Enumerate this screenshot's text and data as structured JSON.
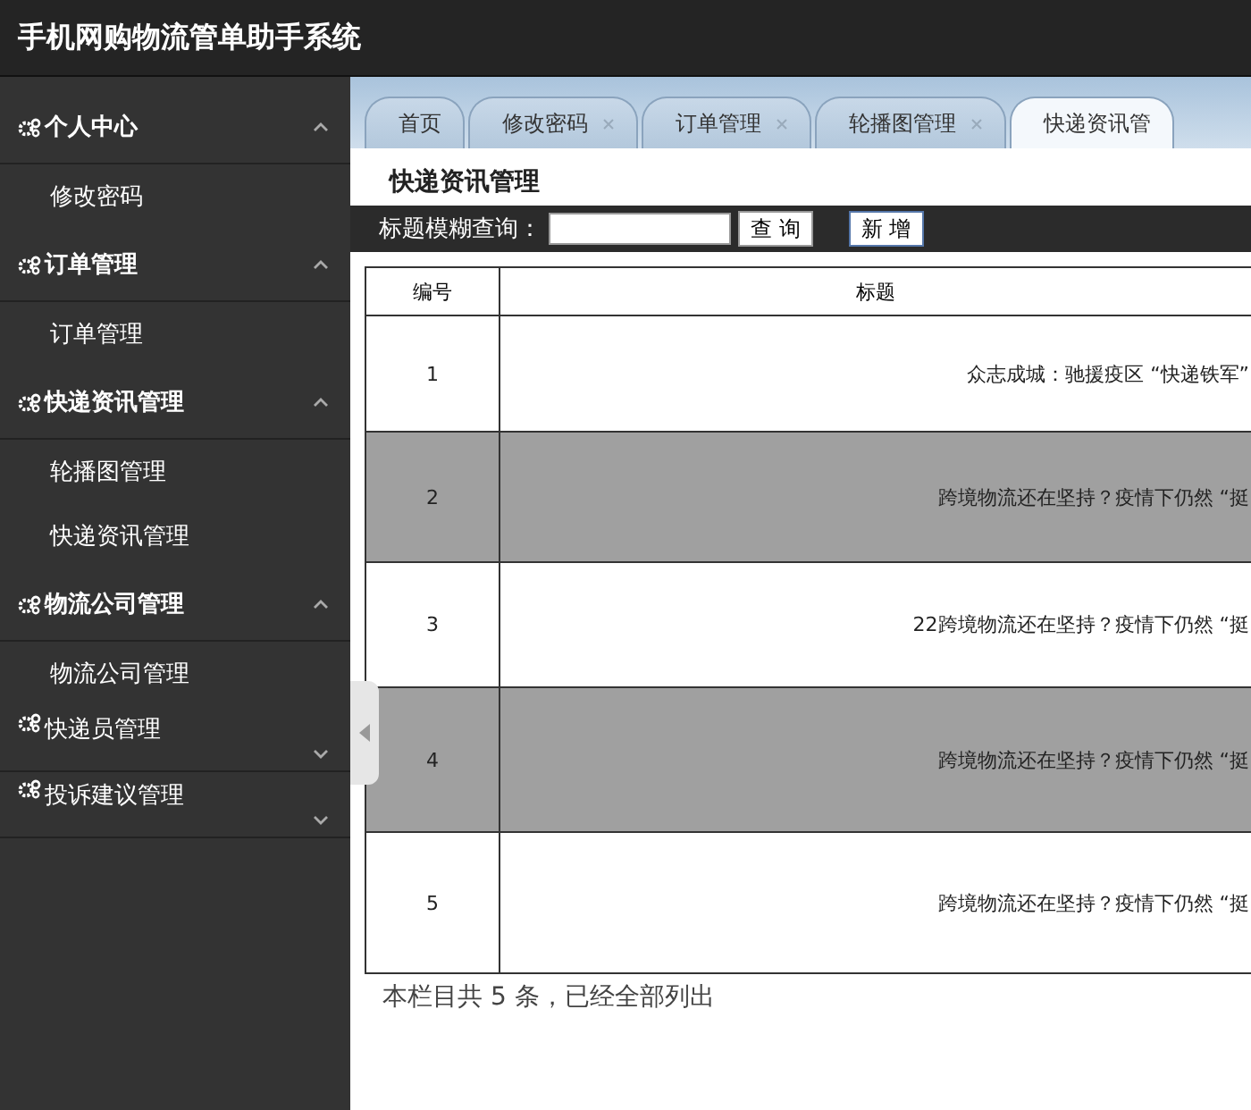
{
  "app_title": "手机网购物流管单助手系统",
  "sidebar": [
    {
      "label": "个人中心",
      "expanded": true,
      "children": [
        {
          "label": "修改密码"
        }
      ]
    },
    {
      "label": "订单管理",
      "expanded": true,
      "children": [
        {
          "label": "订单管理"
        }
      ]
    },
    {
      "label": "快递资讯管理",
      "expanded": true,
      "children": [
        {
          "label": "轮播图管理"
        },
        {
          "label": "快递资讯管理"
        }
      ]
    },
    {
      "label": "物流公司管理",
      "expanded": true,
      "children": [
        {
          "label": "物流公司管理"
        }
      ]
    },
    {
      "label": "快递员管理",
      "expanded": false
    },
    {
      "label": "投诉建议管理",
      "expanded": false
    }
  ],
  "tabs": [
    {
      "label": "首页",
      "selected": false,
      "closable": false
    },
    {
      "label": "修改密码",
      "selected": false,
      "closable": true
    },
    {
      "label": "订单管理",
      "selected": false,
      "closable": true
    },
    {
      "label": "轮播图管理",
      "selected": false,
      "closable": true
    },
    {
      "label": "快递资讯管",
      "selected": true,
      "closable": false
    }
  ],
  "page_title": "快递资讯管理",
  "search": {
    "label": "标题模糊查询：",
    "query_button": "查 询",
    "add_button": "新 增"
  },
  "table": {
    "columns": [
      "编号",
      "标题"
    ],
    "rows": [
      [
        "1",
        "众志成城：驰援疫区 “快递铁军”"
      ],
      [
        "2",
        "跨境物流还在坚持？疫情下仍然 “挺"
      ],
      [
        "3",
        "22跨境物流还在坚持？疫情下仍然 “挺"
      ],
      [
        "4",
        "跨境物流还在坚持？疫情下仍然 “挺"
      ],
      [
        "5",
        "跨境物流还在坚持？疫情下仍然 “挺"
      ]
    ]
  },
  "footer": "本栏目共 5 条，已经全部列出"
}
